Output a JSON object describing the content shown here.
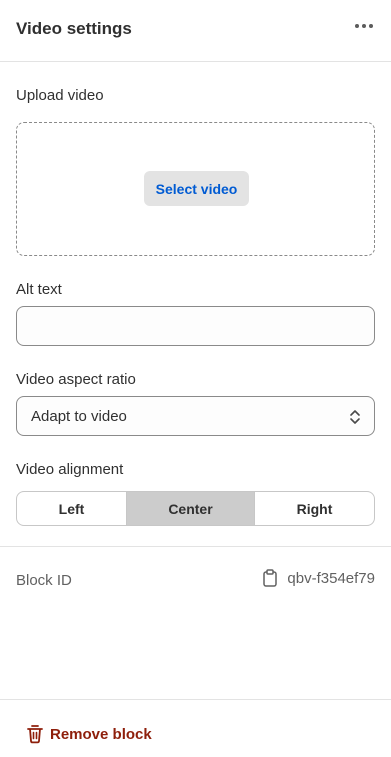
{
  "header": {
    "title": "Video settings",
    "more_icon": "more-horizontal-icon"
  },
  "upload": {
    "label": "Upload video",
    "button_label": "Select video"
  },
  "alt_text": {
    "label": "Alt text",
    "value": "",
    "placeholder": ""
  },
  "aspect_ratio": {
    "label": "Video aspect ratio",
    "selected": "Adapt to video"
  },
  "alignment": {
    "label": "Video alignment",
    "options": [
      "Left",
      "Center",
      "Right"
    ],
    "selected": "Center"
  },
  "block_id": {
    "label": "Block ID",
    "value": "qbv-f354ef79",
    "icon": "clipboard-icon"
  },
  "footer": {
    "remove_label": "Remove block",
    "remove_icon": "trash-icon"
  },
  "colors": {
    "link_blue": "#005bd3",
    "critical_red": "#8e1f0b",
    "selected_segment": "#cccccc"
  }
}
